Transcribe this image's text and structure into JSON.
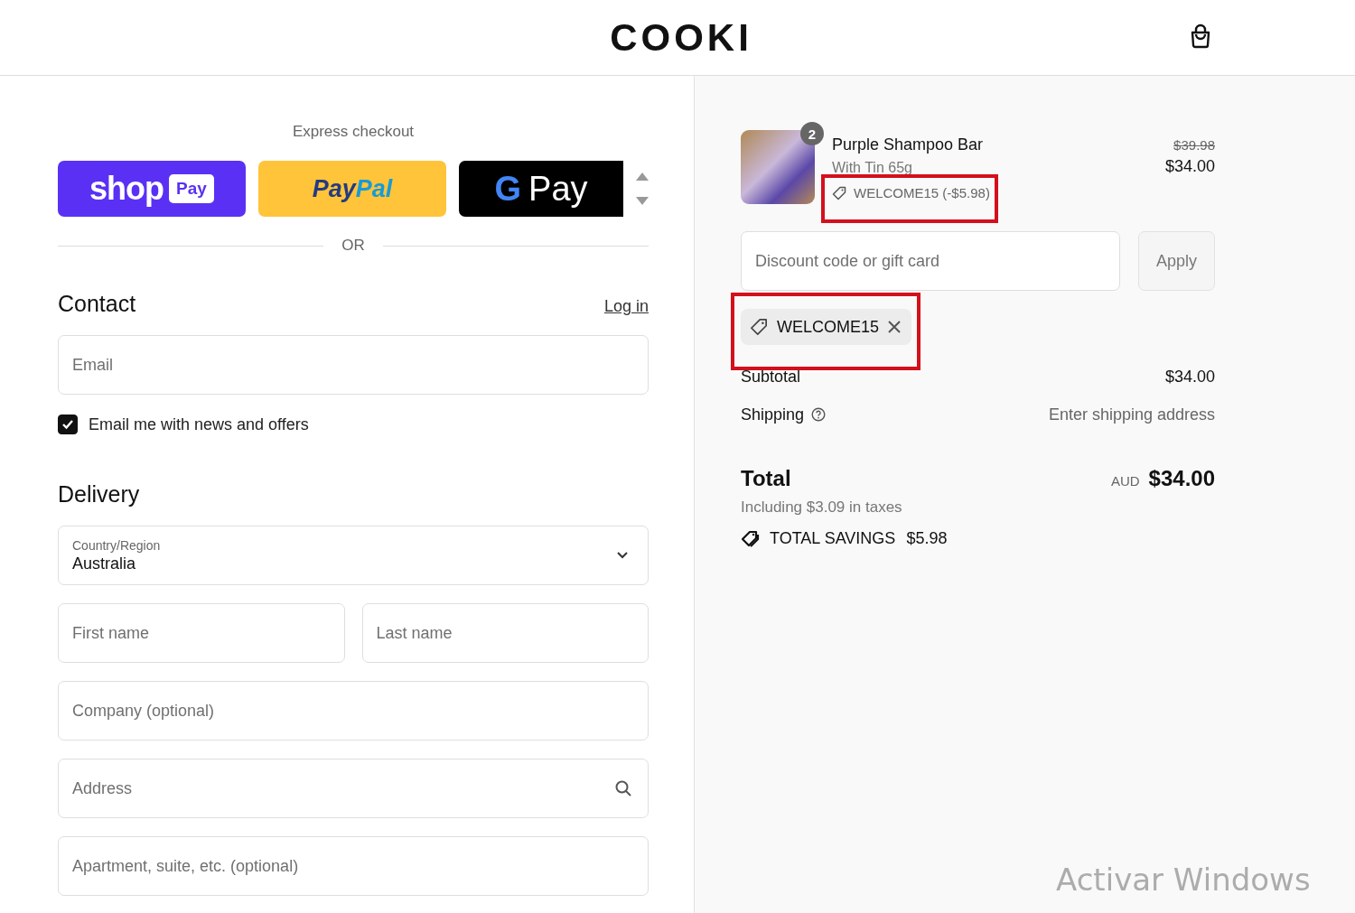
{
  "header": {
    "logo": "COOKI"
  },
  "express": {
    "heading": "Express checkout",
    "buttons": [
      {
        "kind": "shop",
        "parts": [
          "shop",
          "Pay"
        ]
      },
      {
        "kind": "paypal",
        "parts": [
          "Pay",
          "Pal"
        ]
      },
      {
        "kind": "gpay",
        "parts": [
          "G",
          "Pay"
        ]
      }
    ],
    "divider": "OR"
  },
  "contact": {
    "heading": "Contact",
    "link": "Log in",
    "email": {
      "placeholder": "Email"
    },
    "newsletter": {
      "label": "Email me with news and offers",
      "checked": true
    }
  },
  "delivery": {
    "heading": "Delivery",
    "country": {
      "label": "Country/Region",
      "value": "Australia"
    },
    "rows": [
      [
        {
          "placeholder": "First name",
          "kind": "plain"
        },
        {
          "placeholder": "Last name",
          "kind": "plain"
        }
      ],
      [
        {
          "placeholder": "Company (optional)",
          "kind": "plain"
        }
      ],
      [
        {
          "placeholder": "Address",
          "kind": "search"
        }
      ],
      [
        {
          "placeholder": "Apartment, suite, etc. (optional)",
          "kind": "plain"
        }
      ]
    ]
  },
  "summary": {
    "item": {
      "quantity": "2",
      "name": "Purple Shampoo Bar",
      "variant": "With Tin 65g",
      "discount": "WELCOME15 (-$5.98)",
      "highlighted": true,
      "original_price": "$39.98",
      "price": "$34.00"
    },
    "discount_field": {
      "placeholder": "Discount code or gift card"
    },
    "apply": {
      "label": "Apply",
      "disabled": true
    },
    "applied_code": {
      "code": "WELCOME15",
      "highlighted": true
    },
    "subtotal": {
      "label": "Subtotal",
      "value": "$34.00"
    },
    "shipping": {
      "label": "Shipping",
      "value": "Enter shipping address"
    },
    "total": {
      "label": "Total",
      "currency": "AUD",
      "amount": "$34.00"
    },
    "taxes": "Including $3.09 in taxes",
    "savings": {
      "label": "TOTAL SAVINGS",
      "amount": "$5.98"
    }
  },
  "os_overlay": {
    "text": "Activar Windows"
  }
}
